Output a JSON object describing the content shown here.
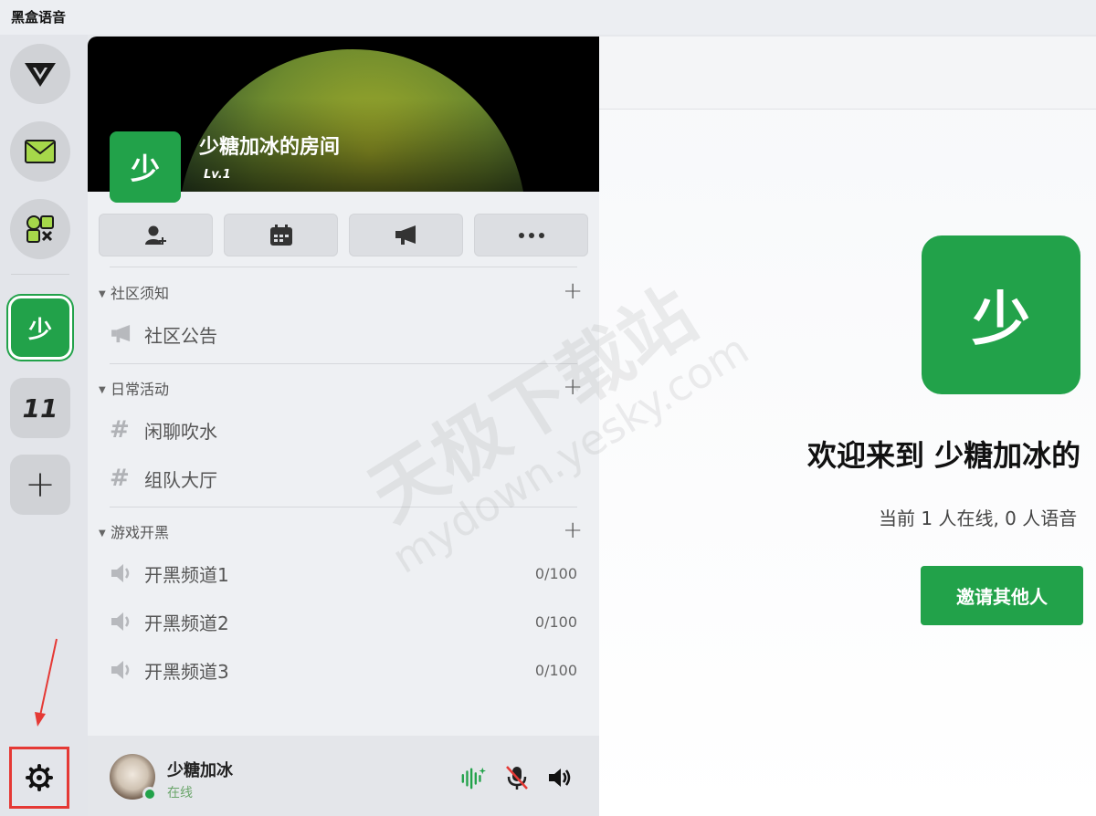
{
  "app": {
    "title": "黑盒语音"
  },
  "rail": {
    "selected_room_initial": "少",
    "second_room_label": "11",
    "add_label": "+"
  },
  "room": {
    "initial": "少",
    "title": "少糖加冰的房间",
    "level": "Lv.1"
  },
  "categories": [
    {
      "name": "社区须知",
      "channels": [
        {
          "name": "社区公告",
          "type": "announcement"
        }
      ]
    },
    {
      "name": "日常活动",
      "channels": [
        {
          "name": "闲聊吹水",
          "type": "text"
        },
        {
          "name": "组队大厅",
          "type": "text"
        }
      ]
    },
    {
      "name": "游戏开黑",
      "channels": [
        {
          "name": "开黑频道1",
          "type": "voice",
          "count": "0/100"
        },
        {
          "name": "开黑频道2",
          "type": "voice",
          "count": "0/100"
        },
        {
          "name": "开黑频道3",
          "type": "voice",
          "count": "0/100"
        }
      ]
    }
  ],
  "user": {
    "name": "少糖加冰",
    "status": "在线"
  },
  "main": {
    "initial": "少",
    "welcome": "欢迎来到 少糖加冰的",
    "online_info": "当前 1 人在线, 0 人语音",
    "invite_label": "邀请其他人"
  },
  "watermark": {
    "line1": "天极下载站",
    "line2": "mydown.yesky.com"
  },
  "colors": {
    "accent": "#22a24a",
    "highlight": "#e53935"
  }
}
